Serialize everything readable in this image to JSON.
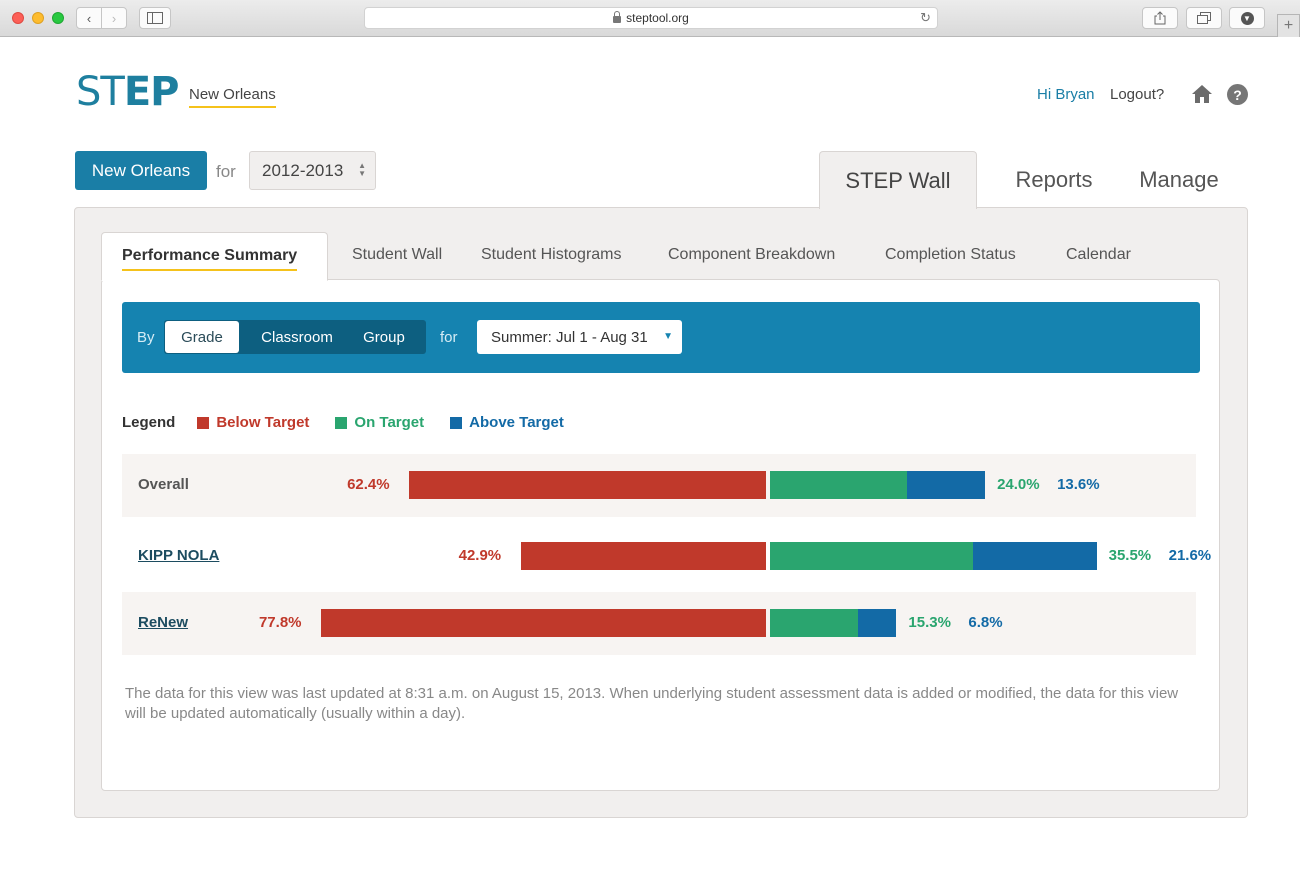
{
  "browser": {
    "url": "steptool.org"
  },
  "header": {
    "logo": "STEP",
    "region": "New Orleans",
    "greeting": "Hi Bryan",
    "logout": "Logout?",
    "help_glyph": "?"
  },
  "selectors": {
    "district": "New Orleans",
    "for_label": "for",
    "year": "2012-2013"
  },
  "main_tabs": [
    {
      "label": "STEP Wall",
      "active": true
    },
    {
      "label": "Reports",
      "active": false
    },
    {
      "label": "Manage",
      "active": false
    }
  ],
  "sub_tabs": [
    {
      "label": "Performance Summary",
      "active": true
    },
    {
      "label": "Student Wall",
      "active": false
    },
    {
      "label": "Student Histograms",
      "active": false
    },
    {
      "label": "Component Breakdown",
      "active": false
    },
    {
      "label": "Completion Status",
      "active": false
    },
    {
      "label": "Calendar",
      "active": false
    }
  ],
  "filter": {
    "by_label": "By",
    "options": [
      "Grade",
      "Classroom",
      "Group"
    ],
    "selected": "Grade",
    "for_label": "for",
    "period": "Summer: Jul 1 - Aug 31"
  },
  "legend": {
    "title": "Legend",
    "items": [
      {
        "label": "Below Target",
        "color": "#c0392b"
      },
      {
        "label": "On Target",
        "color": "#2aa56f"
      },
      {
        "label": "Above Target",
        "color": "#136aa6"
      }
    ]
  },
  "chart_data": {
    "type": "bar",
    "stacked": "diverging",
    "categories": [
      "Overall",
      "KIPP NOLA",
      "ReNew"
    ],
    "series": [
      {
        "name": "Below Target",
        "values": [
          62.4,
          42.9,
          77.8
        ],
        "labels": [
          "62.4%",
          "42.9%",
          "77.8%"
        ]
      },
      {
        "name": "On Target",
        "values": [
          24.0,
          35.5,
          15.3
        ],
        "labels": [
          "24.0%",
          "35.5%",
          "15.3%"
        ]
      },
      {
        "name": "Above Target",
        "values": [
          13.6,
          21.6,
          6.8
        ],
        "labels": [
          "13.6%",
          "21.6%",
          "6.8%"
        ]
      }
    ]
  },
  "rows": [
    {
      "label": "Overall",
      "link": false
    },
    {
      "label": "KIPP NOLA",
      "link": true
    },
    {
      "label": "ReNew",
      "link": true
    }
  ],
  "footnote": "The data for this view was last updated at 8:31 a.m. on August 15, 2013. When underlying student assessment data is added or modified, the data for this view will be updated automatically (usually within a day).",
  "icons": {
    "home": "home-icon",
    "help": "help-icon",
    "lock": "lock-icon",
    "reload": "reload-icon"
  }
}
